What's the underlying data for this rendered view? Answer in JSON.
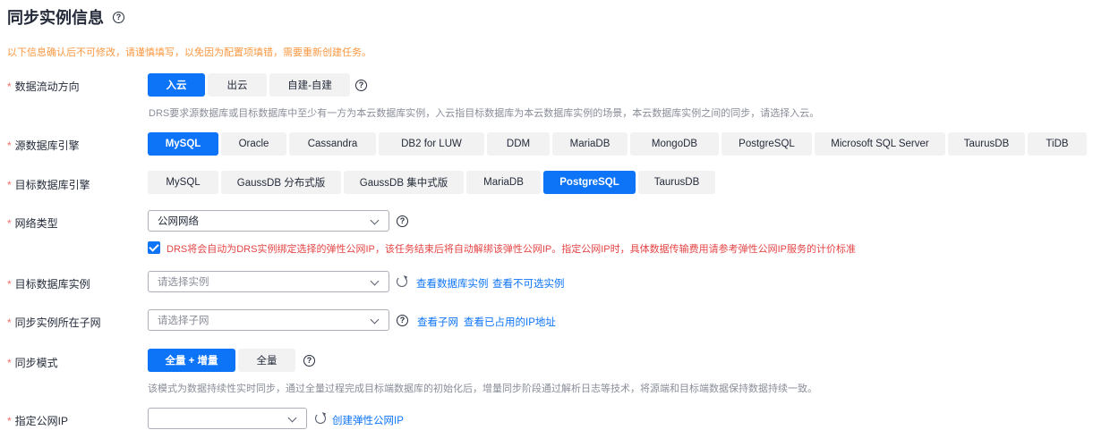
{
  "title": "同步实例信息",
  "warning": "以下信息确认后不可修改，请谨慎填写，以免因为配置项填错，需要重新创建任务。",
  "flow": {
    "label": "数据流动方向",
    "options": [
      "入云",
      "出云",
      "自建-自建"
    ],
    "selected_index": 0,
    "desc": "DRS要求源数据库或目标数据库中至少有一方为本云数据库实例，入云指目标数据库为本云数据库实例的场景，本云数据库实例之间的同步，请选择入云。"
  },
  "source_engine": {
    "label": "源数据库引擎",
    "options": [
      "MySQL",
      "Oracle",
      "Cassandra",
      "DB2 for LUW",
      "DDM",
      "MariaDB",
      "MongoDB",
      "PostgreSQL",
      "Microsoft SQL Server",
      "TaurusDB",
      "TiDB"
    ],
    "selected_index": 0
  },
  "target_engine": {
    "label": "目标数据库引擎",
    "options": [
      "MySQL",
      "GaussDB 分布式版",
      "GaussDB 集中式版",
      "MariaDB",
      "PostgreSQL",
      "TaurusDB"
    ],
    "selected_index": 4
  },
  "network": {
    "label": "网络类型",
    "value": "公网网络",
    "checkbox_text": "DRS将会自动为DRS实例绑定选择的弹性公网IP，该任务结束后将自动解绑该弹性公网IP。指定公网IP时，具体数据传输费用请参考弹性公网IP服务的计价标准"
  },
  "target_instance": {
    "label": "目标数据库实例",
    "placeholder": "请选择实例",
    "link1": "查看数据库实例",
    "link2": "查看不可选实例"
  },
  "subnet": {
    "label": "同步实例所在子网",
    "placeholder": "请选择子网",
    "link1": "查看子网",
    "link2": "查看已占用的IP地址"
  },
  "sync_mode": {
    "label": "同步模式",
    "options": [
      "全量 + 增量",
      "全量"
    ],
    "selected_index": 0,
    "desc": "该模式为数据持续性实时同步，通过全量过程完成目标端数据库的初始化后，增量同步阶段通过解析日志等技术，将源端和目标端数据保持数据持续一致。"
  },
  "public_ip": {
    "label": "指定公网IP",
    "value": "",
    "link": "创建弹性公网IP"
  },
  "help_glyph": "?",
  "colors": {
    "accent": "#0d74f7",
    "required": "#f66f6a",
    "warning": "#fa9841",
    "danger": "#e54545"
  }
}
